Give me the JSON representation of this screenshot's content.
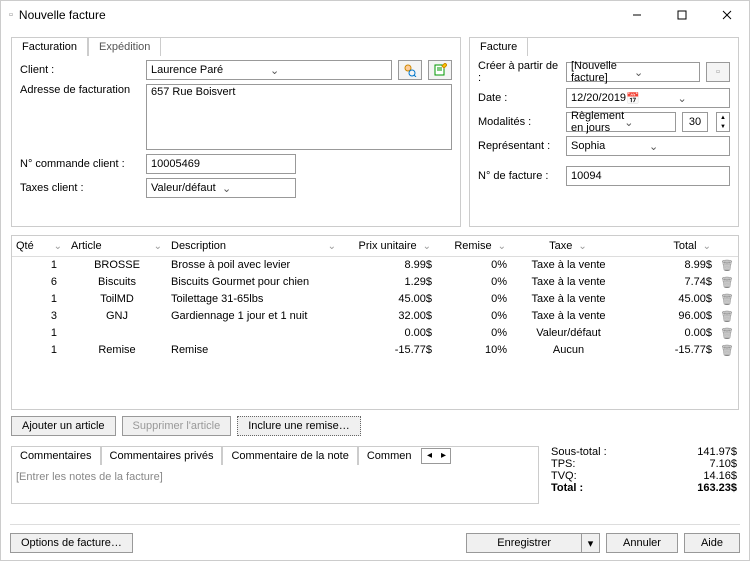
{
  "window": {
    "title": "Nouvelle facture"
  },
  "left": {
    "tab_billing": "Facturation",
    "tab_shipping": "Expédition",
    "client_label": "Client :",
    "client_value": "Laurence Paré",
    "address_label": "Adresse de facturation",
    "address_value": "657 Rue Boisvert",
    "order_label": "N° commande client :",
    "order_value": "10005469",
    "taxes_label": "Taxes client :",
    "taxes_value": "Valeur/défaut"
  },
  "right": {
    "tab_invoice": "Facture",
    "create_label": "Créer à partir de :",
    "create_value": "[Nouvelle facture]",
    "date_label": "Date :",
    "date_value": "12/20/2019",
    "terms_label": "Modalités :",
    "terms_value": "Règlement en jours",
    "terms_days": "30",
    "rep_label": "Représentant :",
    "rep_value": "Sophia",
    "invnum_label": "N° de facture :",
    "invnum_value": "10094"
  },
  "grid": {
    "head": {
      "qte": "Qté",
      "art": "Article",
      "desc": "Description",
      "prix": "Prix unitaire",
      "rem": "Remise",
      "taxe": "Taxe",
      "tot": "Total"
    },
    "rows": [
      {
        "qte": "1",
        "art": "BROSSE",
        "desc": "Brosse à poil avec levier",
        "prix": "8.99$",
        "rem": "0%",
        "taxe": "Taxe à la vente",
        "tot": "8.99$"
      },
      {
        "qte": "6",
        "art": "Biscuits",
        "desc": "Biscuits Gourmet pour chien",
        "prix": "1.29$",
        "rem": "0%",
        "taxe": "Taxe à la vente",
        "tot": "7.74$"
      },
      {
        "qte": "1",
        "art": "ToilMD",
        "desc": "Toilettage 31-65lbs",
        "prix": "45.00$",
        "rem": "0%",
        "taxe": "Taxe à la vente",
        "tot": "45.00$"
      },
      {
        "qte": "3",
        "art": "GNJ",
        "desc": "Gardiennage 1 jour et 1 nuit",
        "prix": "32.00$",
        "rem": "0%",
        "taxe": "Taxe à la vente",
        "tot": "96.00$"
      },
      {
        "qte": "1",
        "art": "",
        "desc": "",
        "prix": "0.00$",
        "rem": "0%",
        "taxe": "Valeur/défaut",
        "tot": "0.00$"
      },
      {
        "qte": "1",
        "art": "Remise",
        "desc": "Remise",
        "prix": "-15.77$",
        "rem": "10%",
        "taxe": "Aucun",
        "tot": "-15.77$"
      }
    ]
  },
  "buttons": {
    "add": "Ajouter un article",
    "del": "Supprimer l'article",
    "discount": "Inclure une remise…"
  },
  "comments": {
    "tab1": "Commentaires",
    "tab2": "Commentaires privés",
    "tab3": "Commentaire de la note",
    "tab4": "Commen",
    "placeholder": "[Entrer les notes de la facture]"
  },
  "totals": {
    "sub_label": "Sous-total :",
    "sub_value": "141.97$",
    "tps_label": "TPS:",
    "tps_value": "7.10$",
    "tvq_label": "TVQ:",
    "tvq_value": "14.16$",
    "tot_label": "Total :",
    "tot_value": "163.23$"
  },
  "footer": {
    "options": "Options de facture…",
    "save": "Enregistrer",
    "cancel": "Annuler",
    "help": "Aide"
  }
}
